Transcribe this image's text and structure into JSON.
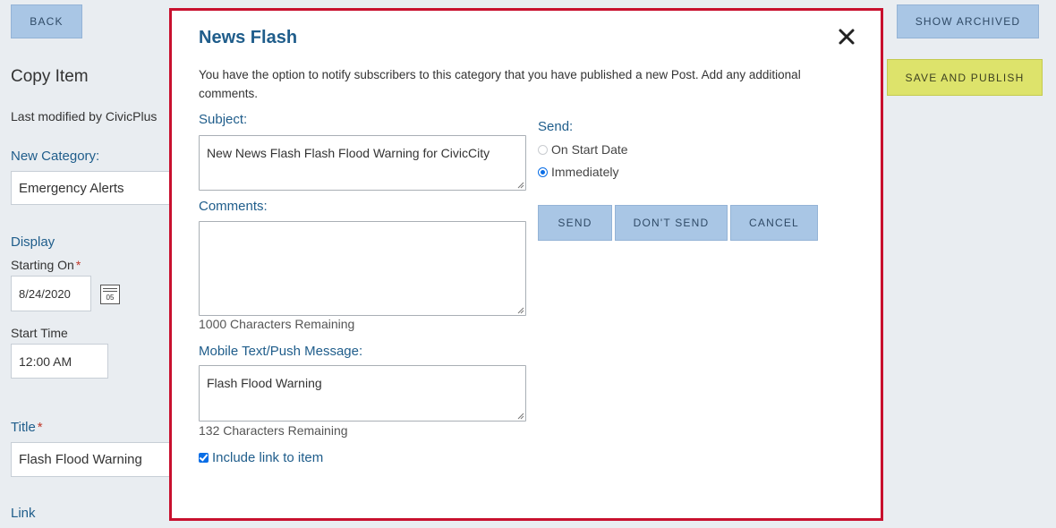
{
  "page": {
    "back_label": "BACK",
    "show_archived_label": "SHOW ARCHIVED",
    "save_publish_label": "SAVE AND PUBLISH",
    "heading": "Copy Item",
    "last_modified": "Last modified by CivicPlus",
    "new_category_label": "New Category:",
    "new_category_value": "Emergency Alerts",
    "display_label": "Display",
    "starting_on_label": "Starting On",
    "starting_on_value": "8/24/2020",
    "calendar_day": "05",
    "start_time_label": "Start Time",
    "start_time_value": "12:00 AM",
    "title_label": "Title",
    "title_value": "Flash Flood Warning",
    "link_label": "Link",
    "required_mark": "*"
  },
  "modal": {
    "title": "News Flash",
    "intro": "You have the option to notify subscribers to this category that you have published a new Post. Add any additional comments.",
    "subject_label": "Subject:",
    "subject_value": "New News Flash Flash Flood Warning for CivicCity",
    "comments_label": "Comments:",
    "comments_value": "",
    "comments_remaining": "1000 Characters Remaining",
    "mobile_label": "Mobile Text/Push Message:",
    "mobile_value": "Flash Flood Warning",
    "mobile_remaining": "132 Characters Remaining",
    "include_link_label": "Include link to item",
    "include_link_checked": true,
    "send_label": "Send:",
    "send_options": [
      {
        "label": "On Start Date",
        "selected": false
      },
      {
        "label": "Immediately",
        "selected": true
      }
    ],
    "buttons": {
      "send": "SEND",
      "dont_send": "DON'T SEND",
      "cancel": "CANCEL"
    }
  },
  "colors": {
    "modal_border": "#c8102e",
    "button_blue": "#a9c6e5",
    "publish_yellow": "#dde36b",
    "label_blue": "#1f5d8b"
  }
}
